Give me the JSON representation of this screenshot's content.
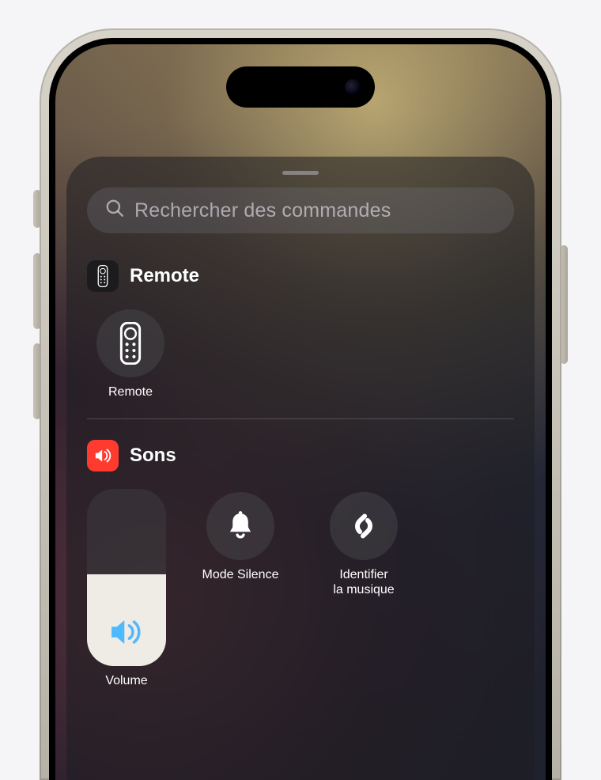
{
  "search": {
    "placeholder": "Rechercher des commandes"
  },
  "sections": {
    "remote": {
      "title": "Remote",
      "items": {
        "remote": {
          "label": "Remote"
        }
      }
    },
    "sons": {
      "title": "Sons",
      "items": {
        "volume": {
          "label": "Volume",
          "level_percent": 52
        },
        "silence": {
          "label": "Mode Silence"
        },
        "shazam": {
          "label": "Identifier\nla musique"
        }
      }
    }
  },
  "colors": {
    "accent_red": "#ff3b30",
    "volume_icon": "#4fb9ff"
  }
}
